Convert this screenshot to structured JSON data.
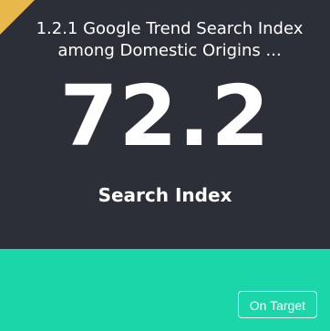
{
  "card": {
    "title": "1.2.1 Google Trend Search Index among Domestic Origins ...",
    "value": "72.2",
    "unit_label": "Search Index",
    "status": "On Target"
  },
  "colors": {
    "card_background": "#2c2f38",
    "status_band": "#1bd6a8",
    "corner_flag": "#e8b84a",
    "text": "#ffffff"
  }
}
